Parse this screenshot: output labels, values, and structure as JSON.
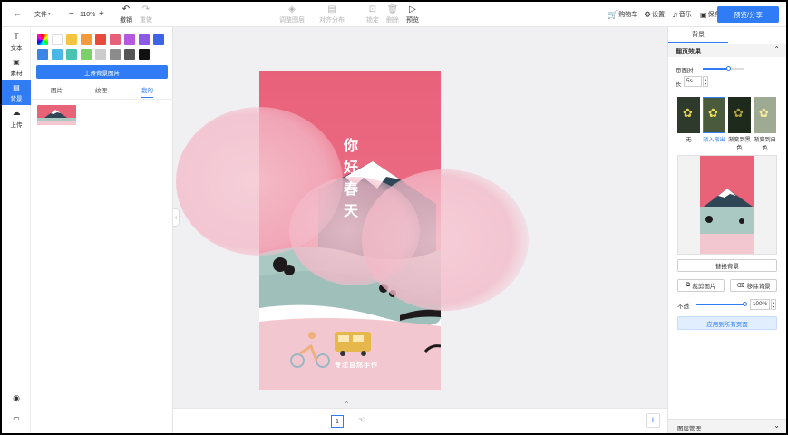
{
  "toolbar": {
    "file_menu": "文件",
    "zoom": "110%",
    "undo": "撤销",
    "redo": "重做",
    "center_item_1": "调整图层",
    "center_item_2": "对齐分布",
    "center_item_3": "锁定",
    "center_item_4": "删除",
    "preview": "预览",
    "cart": "购物车",
    "settings": "设置",
    "music": "音乐",
    "save": "保存",
    "share": "预览/分享"
  },
  "rail": {
    "items": [
      {
        "label": "文本"
      },
      {
        "label": "素材"
      },
      {
        "label": "背景"
      },
      {
        "label": "上传"
      }
    ]
  },
  "left_panel": {
    "upload_bg": "上传背景图片",
    "tabs": [
      {
        "label": "图片"
      },
      {
        "label": "纹理"
      },
      {
        "label": "我的"
      }
    ],
    "swatch_colors": [
      "#ffffff",
      "#f5c542",
      "#f29a3c",
      "#e64b3c",
      "#e6607a",
      "#b657e0",
      "#8c5be6",
      "#3d63e8",
      "#3a86e8",
      "#49b8e6",
      "#49c3b2",
      "#7bd06a",
      "#cccccc",
      "#8c8c8c",
      "#555555",
      "#111111"
    ]
  },
  "poster": {
    "title_chars": [
      "你",
      "好",
      "春",
      "天"
    ],
    "subtitle": "专注自然手作"
  },
  "canvas": {
    "page_number": "1"
  },
  "right_panel": {
    "tab": "背景",
    "section_title": "翻页效果",
    "page_turn_label": "页面时",
    "duration_label": "长",
    "duration_value": "5s",
    "thumbs": [
      {
        "label": "无"
      },
      {
        "label": "渐入渐出"
      },
      {
        "label": "渐变到黑色"
      },
      {
        "label": "渐变到白色"
      }
    ],
    "replace_bg": "替换背景",
    "crop": "裁剪图片",
    "remove_bg": "移除背景",
    "opacity_label": "不透",
    "opacity_value": "100%",
    "apply_all": "应用到所有页面",
    "layers": "图层管理"
  }
}
